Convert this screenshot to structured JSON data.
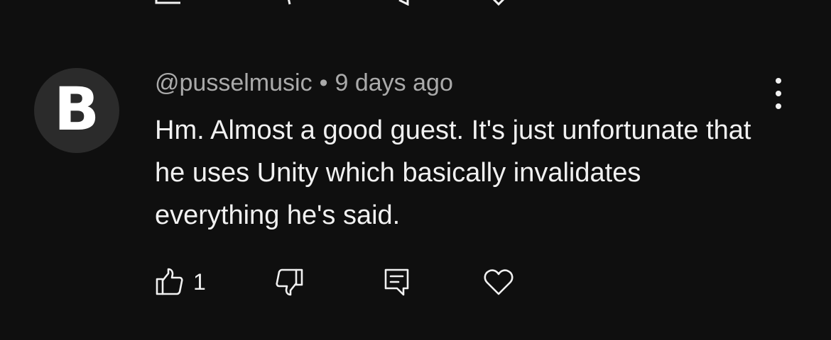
{
  "comment": {
    "avatar_letter": "B",
    "author": "@pusselmusic",
    "separator": "•",
    "timestamp": "9 days ago",
    "text": "Hm. Almost a good guest. It's just unfortunate that he uses Unity which basically invalidates everything he's said.",
    "like_count": "1"
  },
  "icons": {
    "like": "thumbs-up-icon",
    "dislike": "thumbs-down-icon",
    "reply": "reply-icon",
    "heart": "heart-icon",
    "more": "more-vertical-icon"
  },
  "colors": {
    "background": "#0f0f0f",
    "text_primary": "#f1f1f1",
    "text_secondary": "#aaaaaa",
    "avatar_bg": "#2b2b2b"
  }
}
